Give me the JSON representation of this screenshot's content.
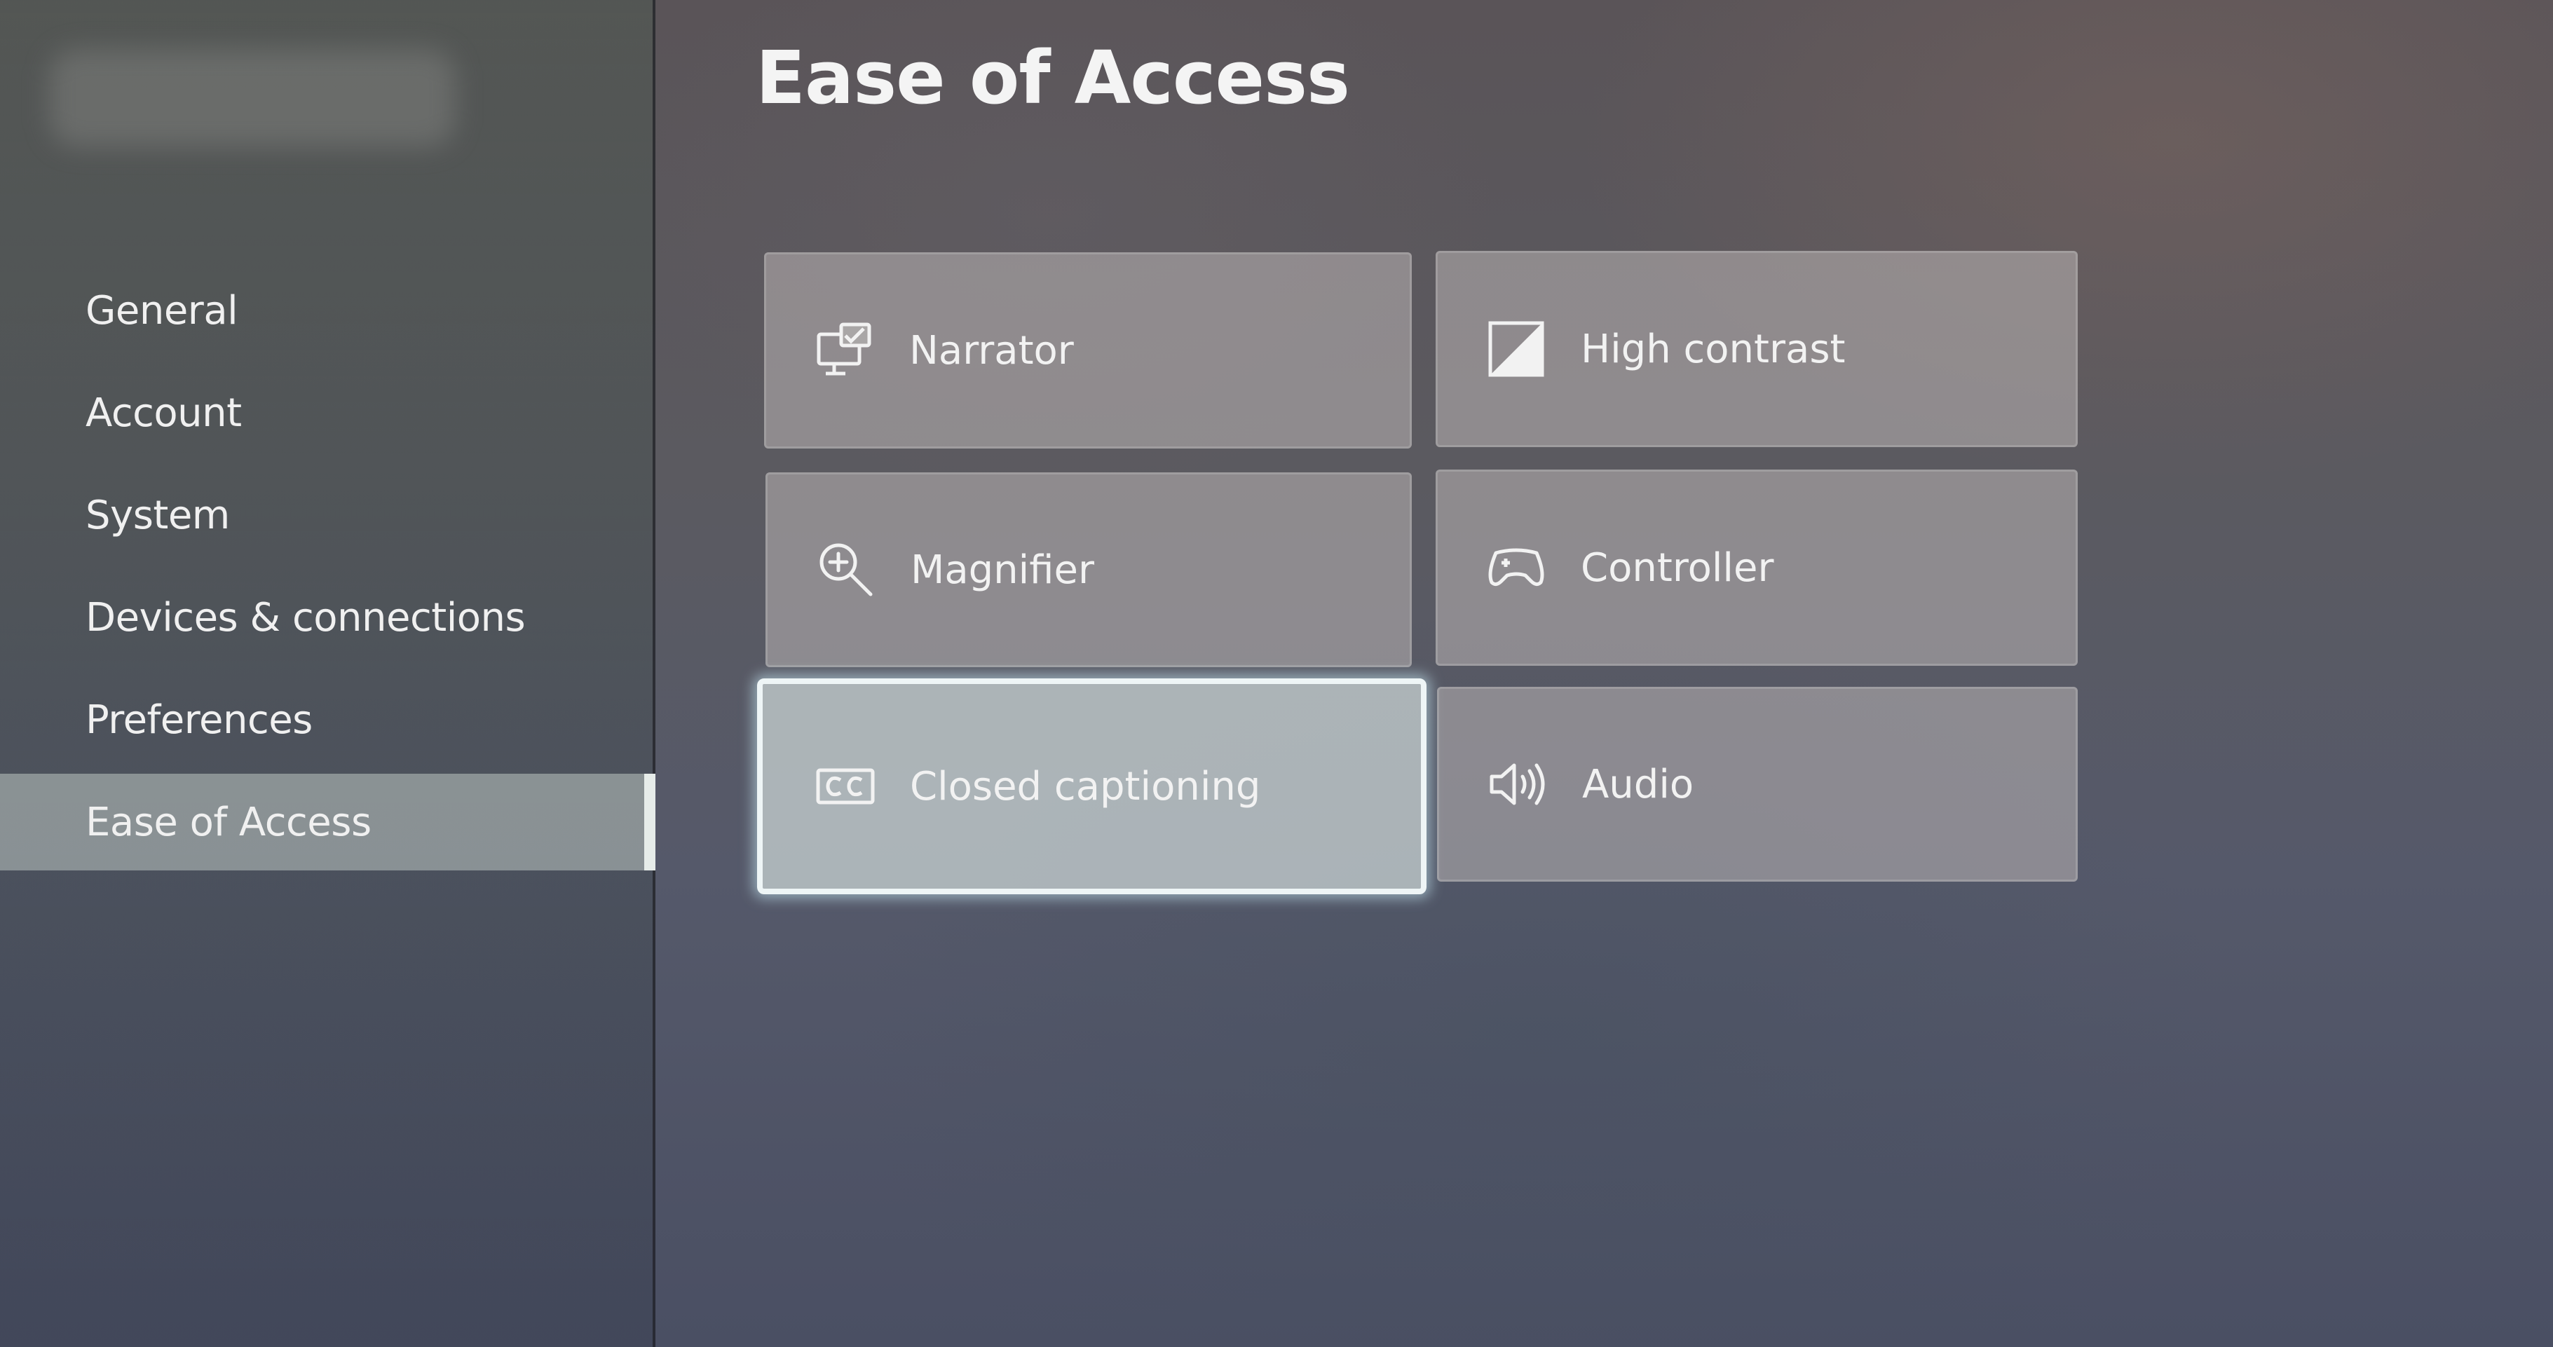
{
  "sidebar": {
    "items": [
      {
        "label": "General"
      },
      {
        "label": "Account"
      },
      {
        "label": "System"
      },
      {
        "label": "Devices & connections"
      },
      {
        "label": "Preferences"
      },
      {
        "label": "Ease of Access",
        "selected": true
      }
    ]
  },
  "page": {
    "title": "Ease of Access"
  },
  "tiles": [
    {
      "label": "Narrator",
      "icon": "narrator-icon"
    },
    {
      "label": "High contrast",
      "icon": "high-contrast-icon"
    },
    {
      "label": "Magnifier",
      "icon": "magnifier-icon"
    },
    {
      "label": "Controller",
      "icon": "controller-icon"
    },
    {
      "label": "Closed captioning",
      "icon": "closed-captioning-icon",
      "focused": true
    },
    {
      "label": "Audio",
      "icon": "speaker-icon"
    }
  ],
  "colors": {
    "focus_outline": "#eef5f6",
    "selected_nav": "#e6ece9",
    "text": "#f2f2f2"
  }
}
